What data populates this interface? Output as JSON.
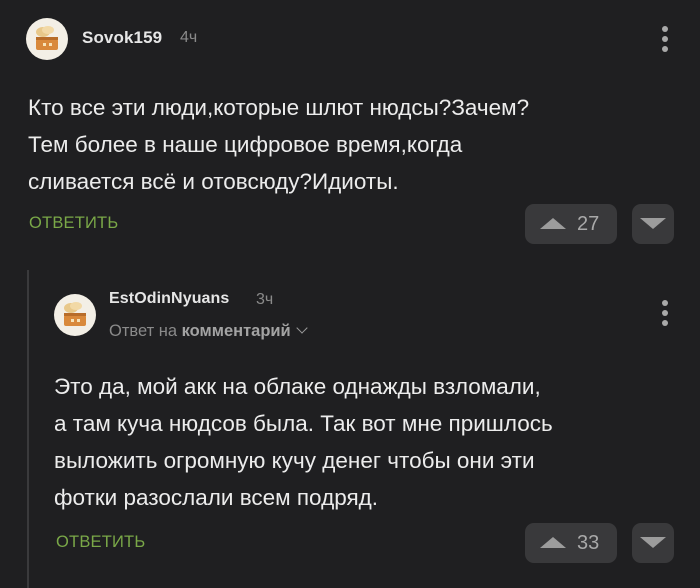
{
  "comment": {
    "author": "Sovok159",
    "time": "4ч",
    "text": "Кто все эти люди,которые шлют нюдсы?Зачем?\nТем более в наше цифровое время,когда\nсливается всё и отовсюду?Идиоты.",
    "reply_label": "ОТВЕТИТЬ",
    "rating": "27"
  },
  "reply": {
    "author": "EstOdinNyuans",
    "time": "3ч",
    "reply_to_prefix": "Ответ на",
    "reply_to_link": "комментарий",
    "text": "Это да, мой акк на облаке однажды взломали,\nа там куча нюдсов была. Так вот мне пришлось\nвыложить огромную кучу денег чтобы они эти\nфотки разослали всем подряд.",
    "reply_label": "ОТВЕТИТЬ",
    "rating": "33"
  },
  "colors": {
    "background": "#1f1f21",
    "accent_green": "#7aa848",
    "vote_button_bg": "#39393b"
  },
  "icons": {
    "avatar": "default-avatar-icon",
    "more": "kebab-menu-icon",
    "upvote": "triangle-up-icon",
    "downvote": "triangle-down-icon",
    "reply_to": "chevron-down-icon"
  }
}
